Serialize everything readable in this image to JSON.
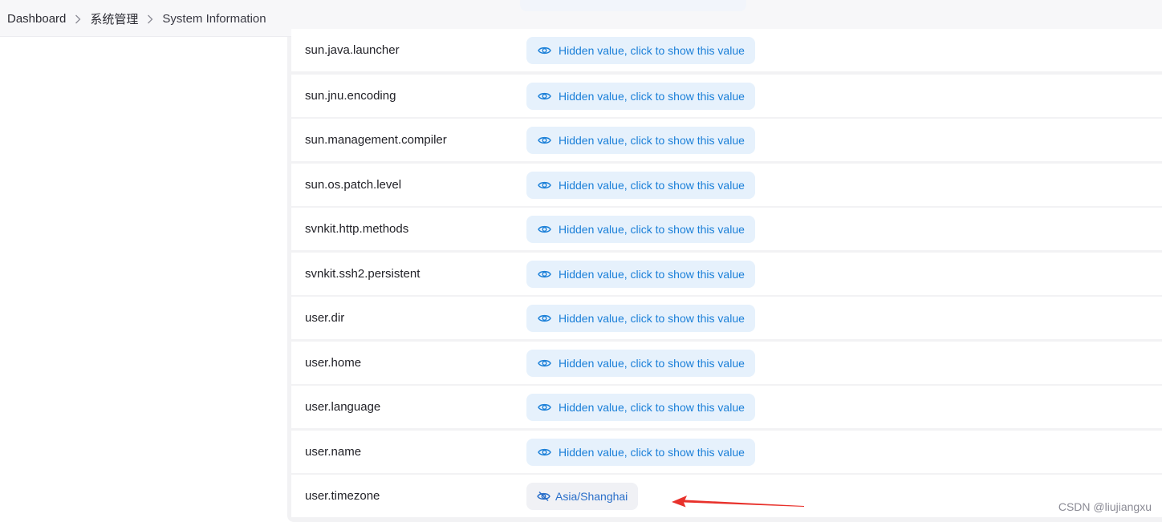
{
  "breadcrumb": {
    "items": [
      "Dashboard",
      "系统管理",
      "System Information"
    ]
  },
  "properties": [
    {
      "key": "sun.java.launcher",
      "value": "Hidden value, click to show this value",
      "revealed": false
    },
    {
      "key": "sun.jnu.encoding",
      "value": "Hidden value, click to show this value",
      "revealed": false
    },
    {
      "key": "sun.management.compiler",
      "value": "Hidden value, click to show this value",
      "revealed": false
    },
    {
      "key": "sun.os.patch.level",
      "value": "Hidden value, click to show this value",
      "revealed": false
    },
    {
      "key": "svnkit.http.methods",
      "value": "Hidden value, click to show this value",
      "revealed": false
    },
    {
      "key": "svnkit.ssh2.persistent",
      "value": "Hidden value, click to show this value",
      "revealed": false
    },
    {
      "key": "user.dir",
      "value": "Hidden value, click to show this value",
      "revealed": false
    },
    {
      "key": "user.home",
      "value": "Hidden value, click to show this value",
      "revealed": false
    },
    {
      "key": "user.language",
      "value": "Hidden value, click to show this value",
      "revealed": false
    },
    {
      "key": "user.name",
      "value": "Hidden value, click to show this value",
      "revealed": false
    },
    {
      "key": "user.timezone",
      "value": "Asia/Shanghai",
      "revealed": true
    }
  ],
  "icons": {
    "hidden": "eye-icon",
    "revealed": "eye-off-icon",
    "separator": "chevron-right-icon"
  },
  "colors": {
    "accent": "#1a7fd8",
    "pill_bg": "#e6f1fc",
    "annotation_arrow": "#e8312b"
  },
  "watermark": "CSDN @liujiangxu"
}
